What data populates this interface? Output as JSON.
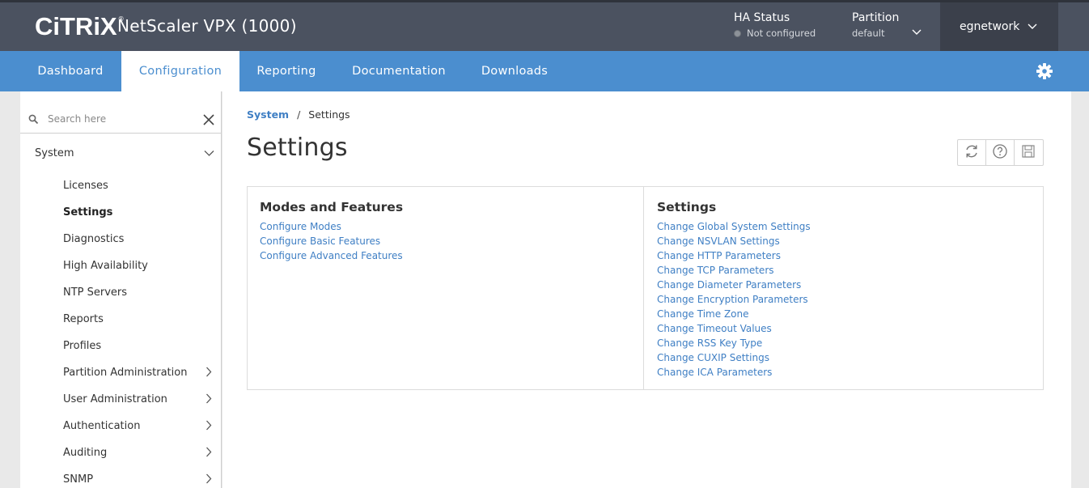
{
  "header": {
    "logo_text": "CiTRiX",
    "logo_tm": "®",
    "product_title": "NetScaler VPX (1000)",
    "ha_status_label": "HA Status",
    "ha_status_value": "Not configured",
    "partition_label": "Partition",
    "partition_value": "default",
    "user_name": "egnetwork"
  },
  "nav": {
    "tabs": [
      {
        "label": "Dashboard",
        "active": false
      },
      {
        "label": "Configuration",
        "active": true
      },
      {
        "label": "Reporting",
        "active": false
      },
      {
        "label": "Documentation",
        "active": false
      },
      {
        "label": "Downloads",
        "active": false
      }
    ],
    "settings_icon": "gear-icon"
  },
  "sidebar": {
    "search_placeholder": "Search here",
    "section": "System",
    "items": [
      {
        "label": "Licenses",
        "selected": false,
        "expandable": false
      },
      {
        "label": "Settings",
        "selected": true,
        "expandable": false
      },
      {
        "label": "Diagnostics",
        "selected": false,
        "expandable": false
      },
      {
        "label": "High Availability",
        "selected": false,
        "expandable": false
      },
      {
        "label": "NTP Servers",
        "selected": false,
        "expandable": false
      },
      {
        "label": "Reports",
        "selected": false,
        "expandable": false
      },
      {
        "label": "Profiles",
        "selected": false,
        "expandable": false
      },
      {
        "label": "Partition Administration",
        "selected": false,
        "expandable": true
      },
      {
        "label": "User Administration",
        "selected": false,
        "expandable": true
      },
      {
        "label": "Authentication",
        "selected": false,
        "expandable": true
      },
      {
        "label": "Auditing",
        "selected": false,
        "expandable": true
      },
      {
        "label": "SNMP",
        "selected": false,
        "expandable": true
      }
    ]
  },
  "main": {
    "breadcrumb": {
      "parent": "System",
      "separator": "/",
      "current": "Settings"
    },
    "title": "Settings",
    "toolbar": [
      "refresh-icon",
      "help-icon",
      "save-icon"
    ],
    "modes_features": {
      "title": "Modes and Features",
      "links": [
        "Configure Modes",
        "Configure Basic Features",
        "Configure Advanced Features"
      ]
    },
    "settings": {
      "title": "Settings",
      "links": [
        "Change Global System Settings",
        "Change NSVLAN Settings",
        "Change HTTP Parameters",
        "Change TCP Parameters",
        "Change Diameter Parameters",
        "Change Encryption Parameters",
        "Change Time Zone",
        "Change Timeout Values",
        "Change RSS Key Type",
        "Change CUXIP Settings",
        "Change ICA Parameters"
      ]
    }
  },
  "colors": {
    "header_bg": "#4b5260",
    "nav_bg": "#4b8ecf",
    "link": "#3f7fc4",
    "user_box_bg": "#3b404b"
  }
}
